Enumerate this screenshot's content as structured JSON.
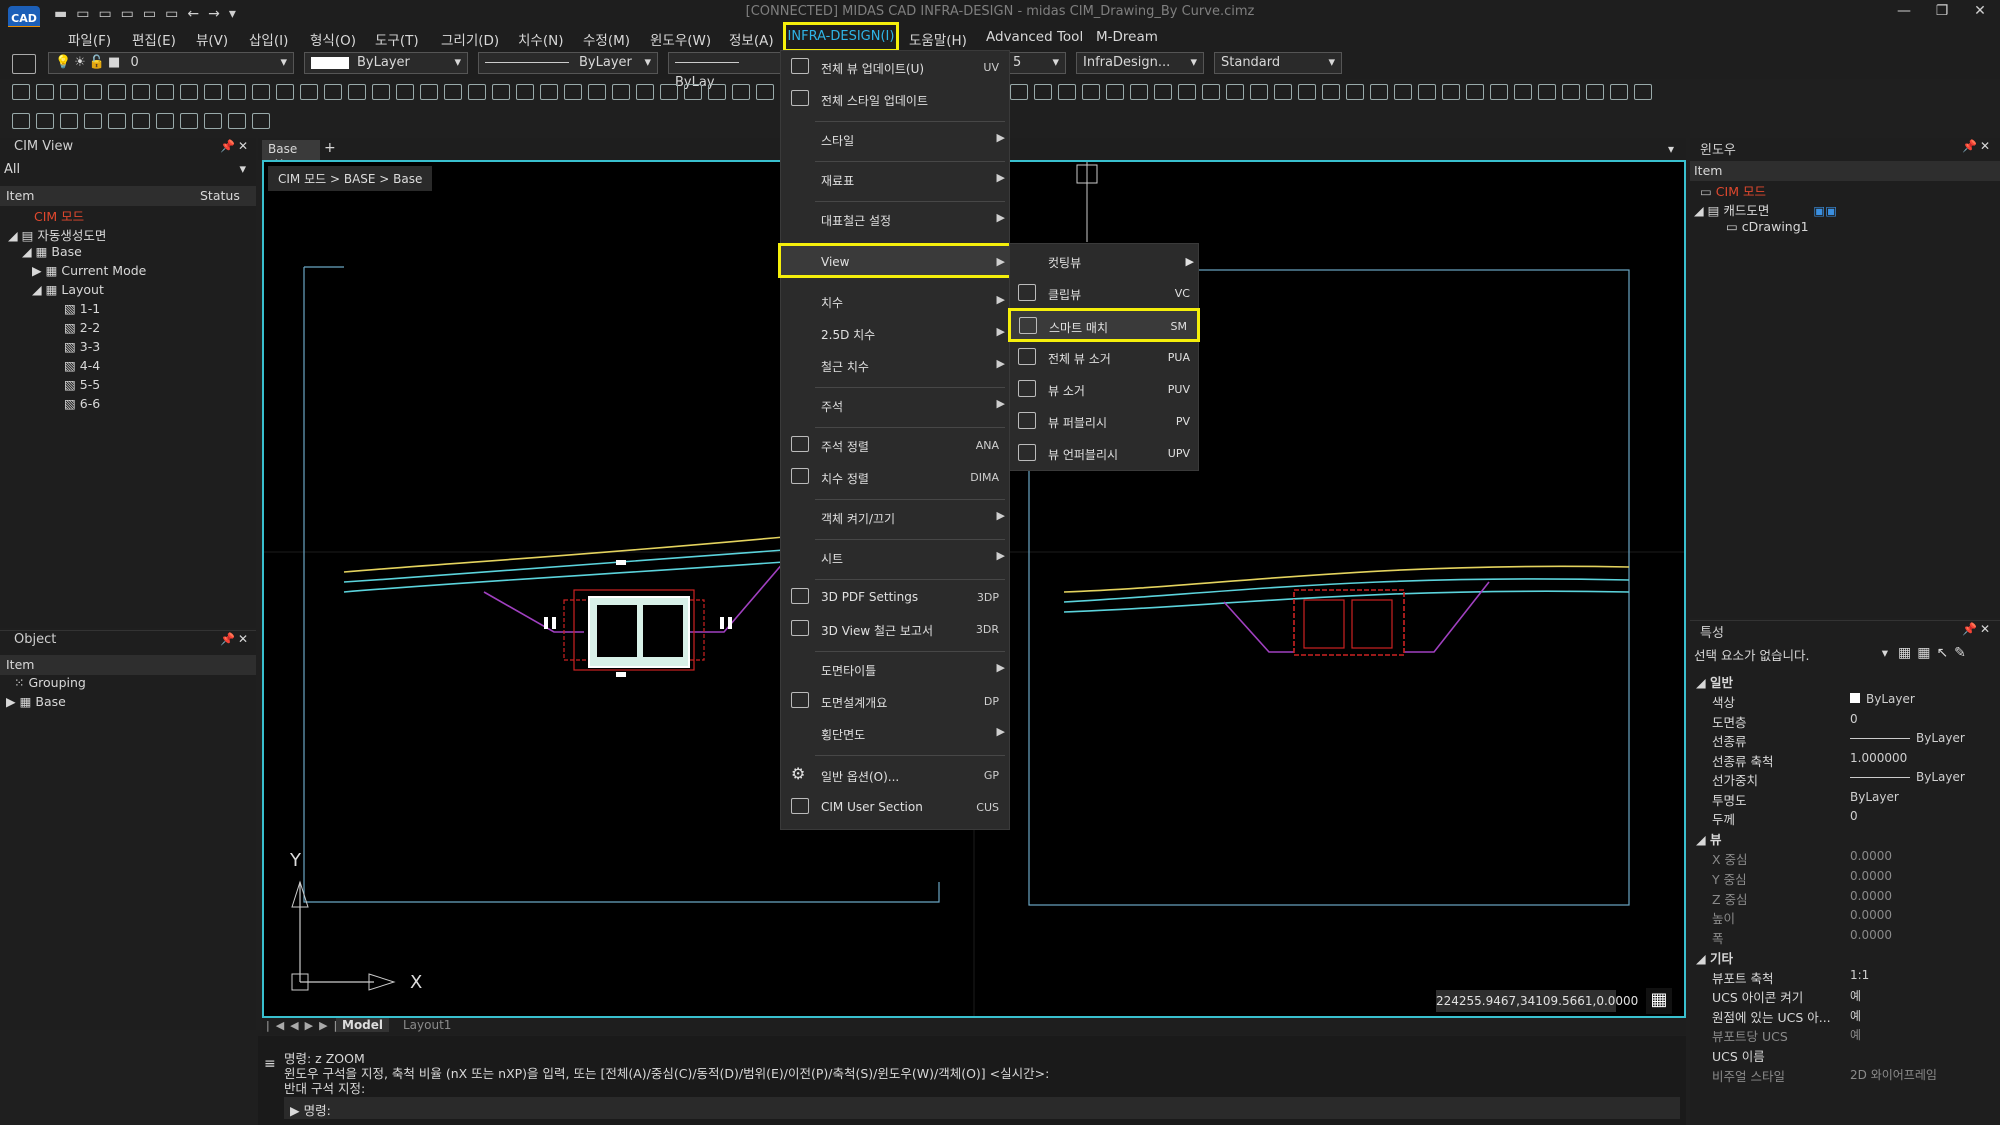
{
  "app": {
    "logo_text": "CAD",
    "title": "[CONNECTED] MIDAS CAD INFRA-DESIGN - midas CIM_Drawing_By Curve.cimz"
  },
  "menu": [
    "파일(F)",
    "편집(E)",
    "뷰(V)",
    "삽입(I)",
    "형식(O)",
    "도구(T)",
    "그리기(D)",
    "치수(N)",
    "수정(M)",
    "윈도우(W)",
    "정보(A)",
    "INFRA-DESIGN(I)",
    "도움말(H)",
    "Advanced Tool",
    "M-Dream"
  ],
  "toolbar": {
    "layer": "0",
    "color": "ByLayer",
    "linetype": "ByLayer",
    "lineweight": "ByLay",
    "dimstyle_partial": "5",
    "dimstyle": "InfraDesign...",
    "textstyle": "Standard"
  },
  "left_panel": {
    "title": "CIM View",
    "filter": "All",
    "col_item": "Item",
    "col_status": "Status",
    "tree": {
      "root": "CIM 모드",
      "auto": "자동생성도면",
      "base": "Base",
      "current_mode": "Current Mode",
      "layout": "Layout",
      "sections": [
        "1-1",
        "2-2",
        "3-3",
        "4-4",
        "5-5",
        "6-6"
      ]
    }
  },
  "object_panel": {
    "title": "Object",
    "col_item": "Item",
    "grouping": "Grouping",
    "base": "Base"
  },
  "doc_tab": {
    "name": "Base",
    "add": "+"
  },
  "breadcrumb": "CIM 모드 > BASE > Base",
  "coords": "224255.9467,34109.5661,0.0000",
  "axes": {
    "x": "X",
    "y": "Y"
  },
  "model_tabs": [
    "Model",
    "Layout1"
  ],
  "command": {
    "lines": [
      "명령: z ZOOM",
      "윈도우 구석을 지정, 축척 비율 (nX 또는 nXP)을 입력, 또는 [전체(A)/중심(C)/동적(D)/범위(E)/이전(P)/축척(S)/윈도우(W)/객체(O)] <실시간>:",
      "반대 구석 지정:"
    ],
    "prompt": "명령:"
  },
  "infra_menu": [
    {
      "label": "전체 뷰 업데이트(U)",
      "shortcut": "UV",
      "icon": "refresh-view-icon"
    },
    {
      "label": "전체 스타일 업데이트",
      "shortcut": "",
      "icon": "refresh-style-icon"
    },
    {
      "label": "스타일",
      "sub": true
    },
    {
      "label": "재료표",
      "sub": true
    },
    {
      "label": "대표철근 설정",
      "sub": true
    },
    {
      "label": "View",
      "sub": true,
      "highlight": true
    },
    {
      "label": "치수",
      "sub": true
    },
    {
      "label": "2.5D 치수",
      "sub": true
    },
    {
      "label": "철근 치수",
      "sub": true
    },
    {
      "label": "주석",
      "sub": true
    },
    {
      "label": "주석 정렬",
      "shortcut": "ANA",
      "icon": "annotation-align-icon"
    },
    {
      "label": "치수 정렬",
      "shortcut": "DIMA",
      "icon": "dimension-align-icon"
    },
    {
      "label": "객체 켜기/끄기",
      "sub": true
    },
    {
      "label": "시트",
      "sub": true
    },
    {
      "label": "3D PDF Settings",
      "shortcut": "3DP",
      "icon": "pdf-icon"
    },
    {
      "label": "3D View 철근 보고서",
      "shortcut": "3DR",
      "icon": "report-icon"
    },
    {
      "label": "도면타이틀",
      "sub": true
    },
    {
      "label": "도면설계개요",
      "shortcut": "DP",
      "icon": "design-overview-icon"
    },
    {
      "label": "횡단면도",
      "sub": true
    },
    {
      "label": "일반 옵션(O)...",
      "shortcut": "GP",
      "icon": "gear-icon"
    },
    {
      "label": "CIM User Section",
      "shortcut": "CUS",
      "icon": "user-section-icon"
    }
  ],
  "view_submenu": [
    {
      "label": "컷팅뷰",
      "sub": true
    },
    {
      "label": "클립뷰",
      "shortcut": "VC",
      "icon": "clip-view-icon"
    },
    {
      "label": "스마트 매치",
      "shortcut": "SM",
      "icon": "smart-match-icon",
      "highlight": true
    },
    {
      "label": "전체 뷰 소거",
      "shortcut": "PUA",
      "icon": "purge-all-view-icon"
    },
    {
      "label": "뷰 소거",
      "shortcut": "PUV",
      "icon": "purge-view-icon"
    },
    {
      "label": "뷰 퍼블리시",
      "shortcut": "PV",
      "icon": "publish-view-icon"
    },
    {
      "label": "뷰 언퍼블리시",
      "shortcut": "UPV",
      "icon": "unpublish-view-icon"
    }
  ],
  "window_panel": {
    "title": "윈도우",
    "col_item": "Item",
    "root": "CIM 모드",
    "cad": "캐드도면",
    "drawing": "cDrawing1"
  },
  "properties": {
    "title": "특성",
    "selection": "선택 요소가 없습니다.",
    "groups": {
      "general": "일반",
      "view": "뷰",
      "misc": "기타"
    },
    "general": [
      {
        "k": "색상",
        "v": "ByLayer"
      },
      {
        "k": "도면층",
        "v": "0"
      },
      {
        "k": "선종류",
        "v": "ByLayer"
      },
      {
        "k": "선종류 축척",
        "v": "1.000000"
      },
      {
        "k": "선가중치",
        "v": "ByLayer"
      },
      {
        "k": "투명도",
        "v": "ByLayer"
      },
      {
        "k": "두께",
        "v": "0"
      }
    ],
    "view": [
      {
        "k": "X 중심",
        "v": "0.0000"
      },
      {
        "k": "Y 중심",
        "v": "0.0000"
      },
      {
        "k": "Z 중심",
        "v": "0.0000"
      },
      {
        "k": "높이",
        "v": "0.0000"
      },
      {
        "k": "폭",
        "v": "0.0000"
      }
    ],
    "misc": [
      {
        "k": "뷰포트 축척",
        "v": "1:1"
      },
      {
        "k": "UCS 아이콘 켜기",
        "v": "예"
      },
      {
        "k": "원점에 있는 UCS 아...",
        "v": "예"
      },
      {
        "k": "뷰포트당 UCS",
        "v": "예"
      },
      {
        "k": "UCS 이름",
        "v": ""
      },
      {
        "k": "비주얼 스타일",
        "v": "2D 와이어프레임"
      }
    ]
  },
  "colors": {
    "accent_cyan": "#39c0cf",
    "highlight": "#f5ef0b",
    "cim_red": "#e0482e",
    "menu_active": "#2fb4e6"
  }
}
